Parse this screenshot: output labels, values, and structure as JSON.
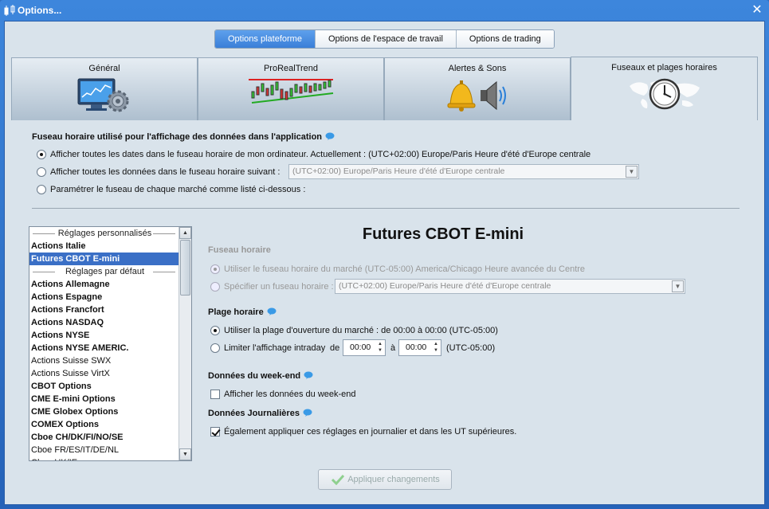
{
  "window": {
    "title": "Options..."
  },
  "segments": [
    {
      "label": "Options plateforme",
      "active": true
    },
    {
      "label": "Options de l'espace de travail",
      "active": false
    },
    {
      "label": "Options de trading",
      "active": false
    }
  ],
  "tabs": [
    {
      "label": "Général",
      "icon": "monitor-gear-icon"
    },
    {
      "label": "ProRealTrend",
      "icon": "trend-chart-icon"
    },
    {
      "label": "Alertes & Sons",
      "icon": "bell-speaker-icon"
    },
    {
      "label": "Fuseaux et plages horaires",
      "icon": "world-clock-icon",
      "active": true
    }
  ],
  "timezone": {
    "heading": "Fuseau horaire utilisé pour l'affichage des données dans l'application",
    "opt1": "Afficher toutes les dates dans le fuseau horaire de mon ordinateur. Actuellement : (UTC+02:00) Europe/Paris Heure d'été d'Europe centrale",
    "opt2": "Afficher toutes les données dans le fuseau horaire suivant :",
    "opt2_value": "(UTC+02:00) Europe/Paris Heure d'été d'Europe centrale",
    "opt3": "Paramétrer le fuseau de chaque marché comme listé ci-dessous :"
  },
  "market_list": {
    "header_custom": "Réglages personnalisés",
    "custom_items": [
      "Actions Italie",
      "Futures CBOT E-mini"
    ],
    "header_default": "Réglages par défaut",
    "default_items": [
      {
        "label": "Actions Allemagne",
        "bold": true
      },
      {
        "label": "Actions Espagne",
        "bold": true
      },
      {
        "label": "Actions Francfort",
        "bold": true
      },
      {
        "label": "Actions NASDAQ",
        "bold": true
      },
      {
        "label": "Actions NYSE",
        "bold": true
      },
      {
        "label": "Actions NYSE AMERIC.",
        "bold": true
      },
      {
        "label": "Actions Suisse SWX",
        "bold": false
      },
      {
        "label": "Actions Suisse VirtX",
        "bold": false
      },
      {
        "label": "CBOT Options",
        "bold": true
      },
      {
        "label": "CME E-mini Options",
        "bold": true
      },
      {
        "label": "CME Globex Options",
        "bold": true
      },
      {
        "label": "COMEX Options",
        "bold": true
      },
      {
        "label": "Cboe CH/DK/FI/NO/SE",
        "bold": true
      },
      {
        "label": "Cboe FR/ES/IT/DE/NL",
        "bold": false
      },
      {
        "label": "Cboe UK/IE",
        "bold": false
      }
    ]
  },
  "detail": {
    "title": "Futures CBOT E-mini",
    "tz_heading": "Fuseau horaire",
    "tz_opt1": "Utiliser le fuseau horaire du marché (UTC-05:00) America/Chicago Heure avancée du Centre",
    "tz_opt2": "Spécifier un fuseau horaire :",
    "tz_opt2_value": "(UTC+02:00) Europe/Paris Heure d'été d'Europe centrale",
    "range_heading": "Plage horaire",
    "range_opt1": "Utiliser la plage d'ouverture du marché : de 00:00 à 00:00  (UTC-05:00)",
    "range_opt2": "Limiter l'affichage intraday",
    "range_de": "de",
    "range_from": "00:00",
    "range_a": "à",
    "range_to": "00:00",
    "range_tz": "(UTC-05:00)",
    "weekend_heading": "Données du week-end",
    "weekend_opt": "Afficher les données du week-end",
    "daily_heading": "Données Journalières",
    "daily_opt": "Également appliquer ces réglages en journalier et dans les UT supérieures."
  },
  "apply_label": "Appliquer changements"
}
